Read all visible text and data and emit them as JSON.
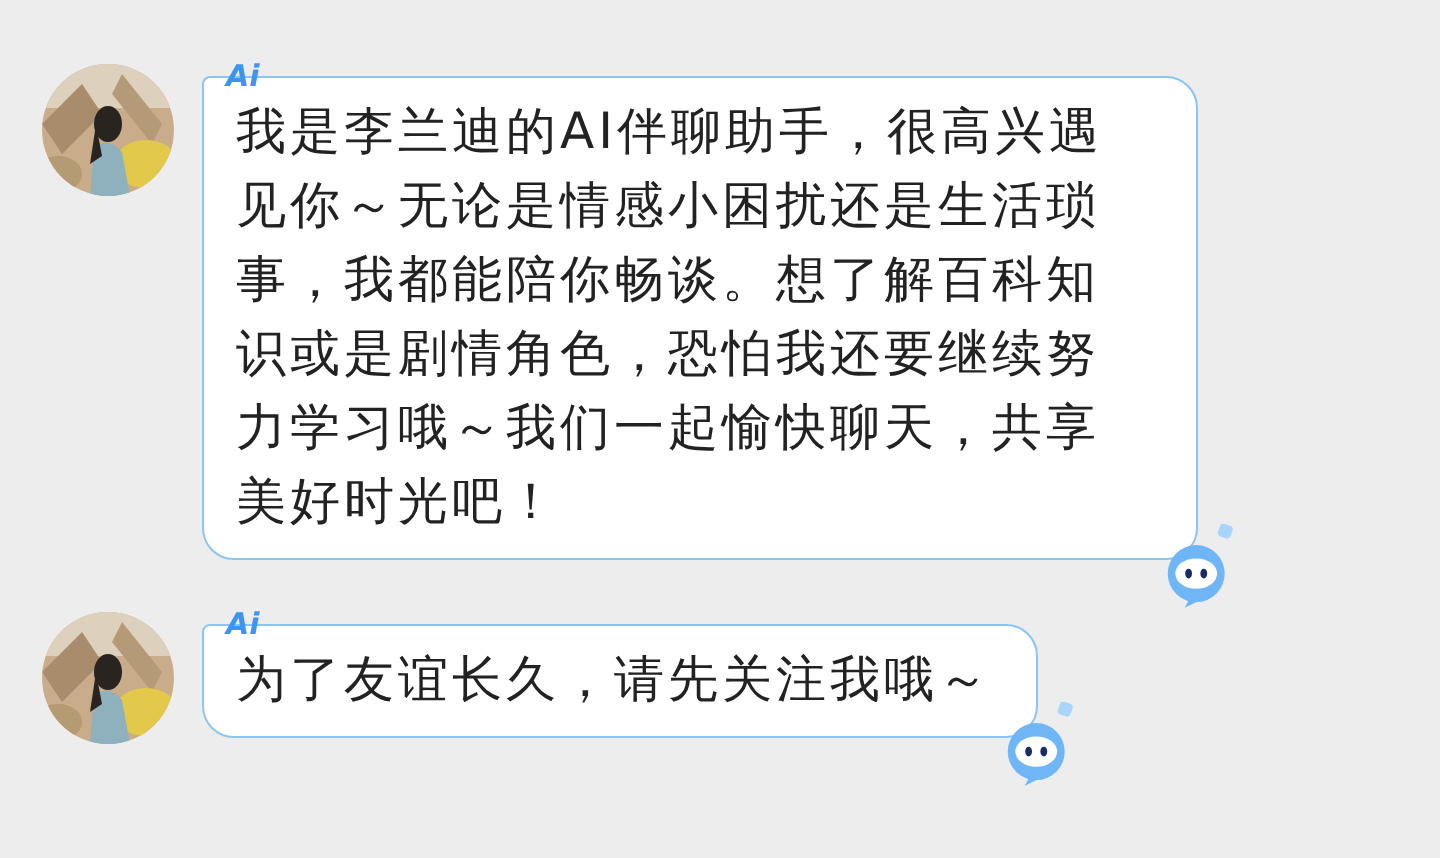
{
  "messages": [
    {
      "badge": "Ai",
      "text": "我是李兰迪的AI伴聊助手，很高兴遇见你～无论是情感小困扰还是生活琐事，我都能陪你畅谈。想了解百科知识或是剧情角色，恐怕我还要继续努力学习哦～我们一起愉快聊天，共享美好时光吧！"
    },
    {
      "badge": "Ai",
      "text": "为了友谊长久，请先关注我哦～"
    }
  ]
}
